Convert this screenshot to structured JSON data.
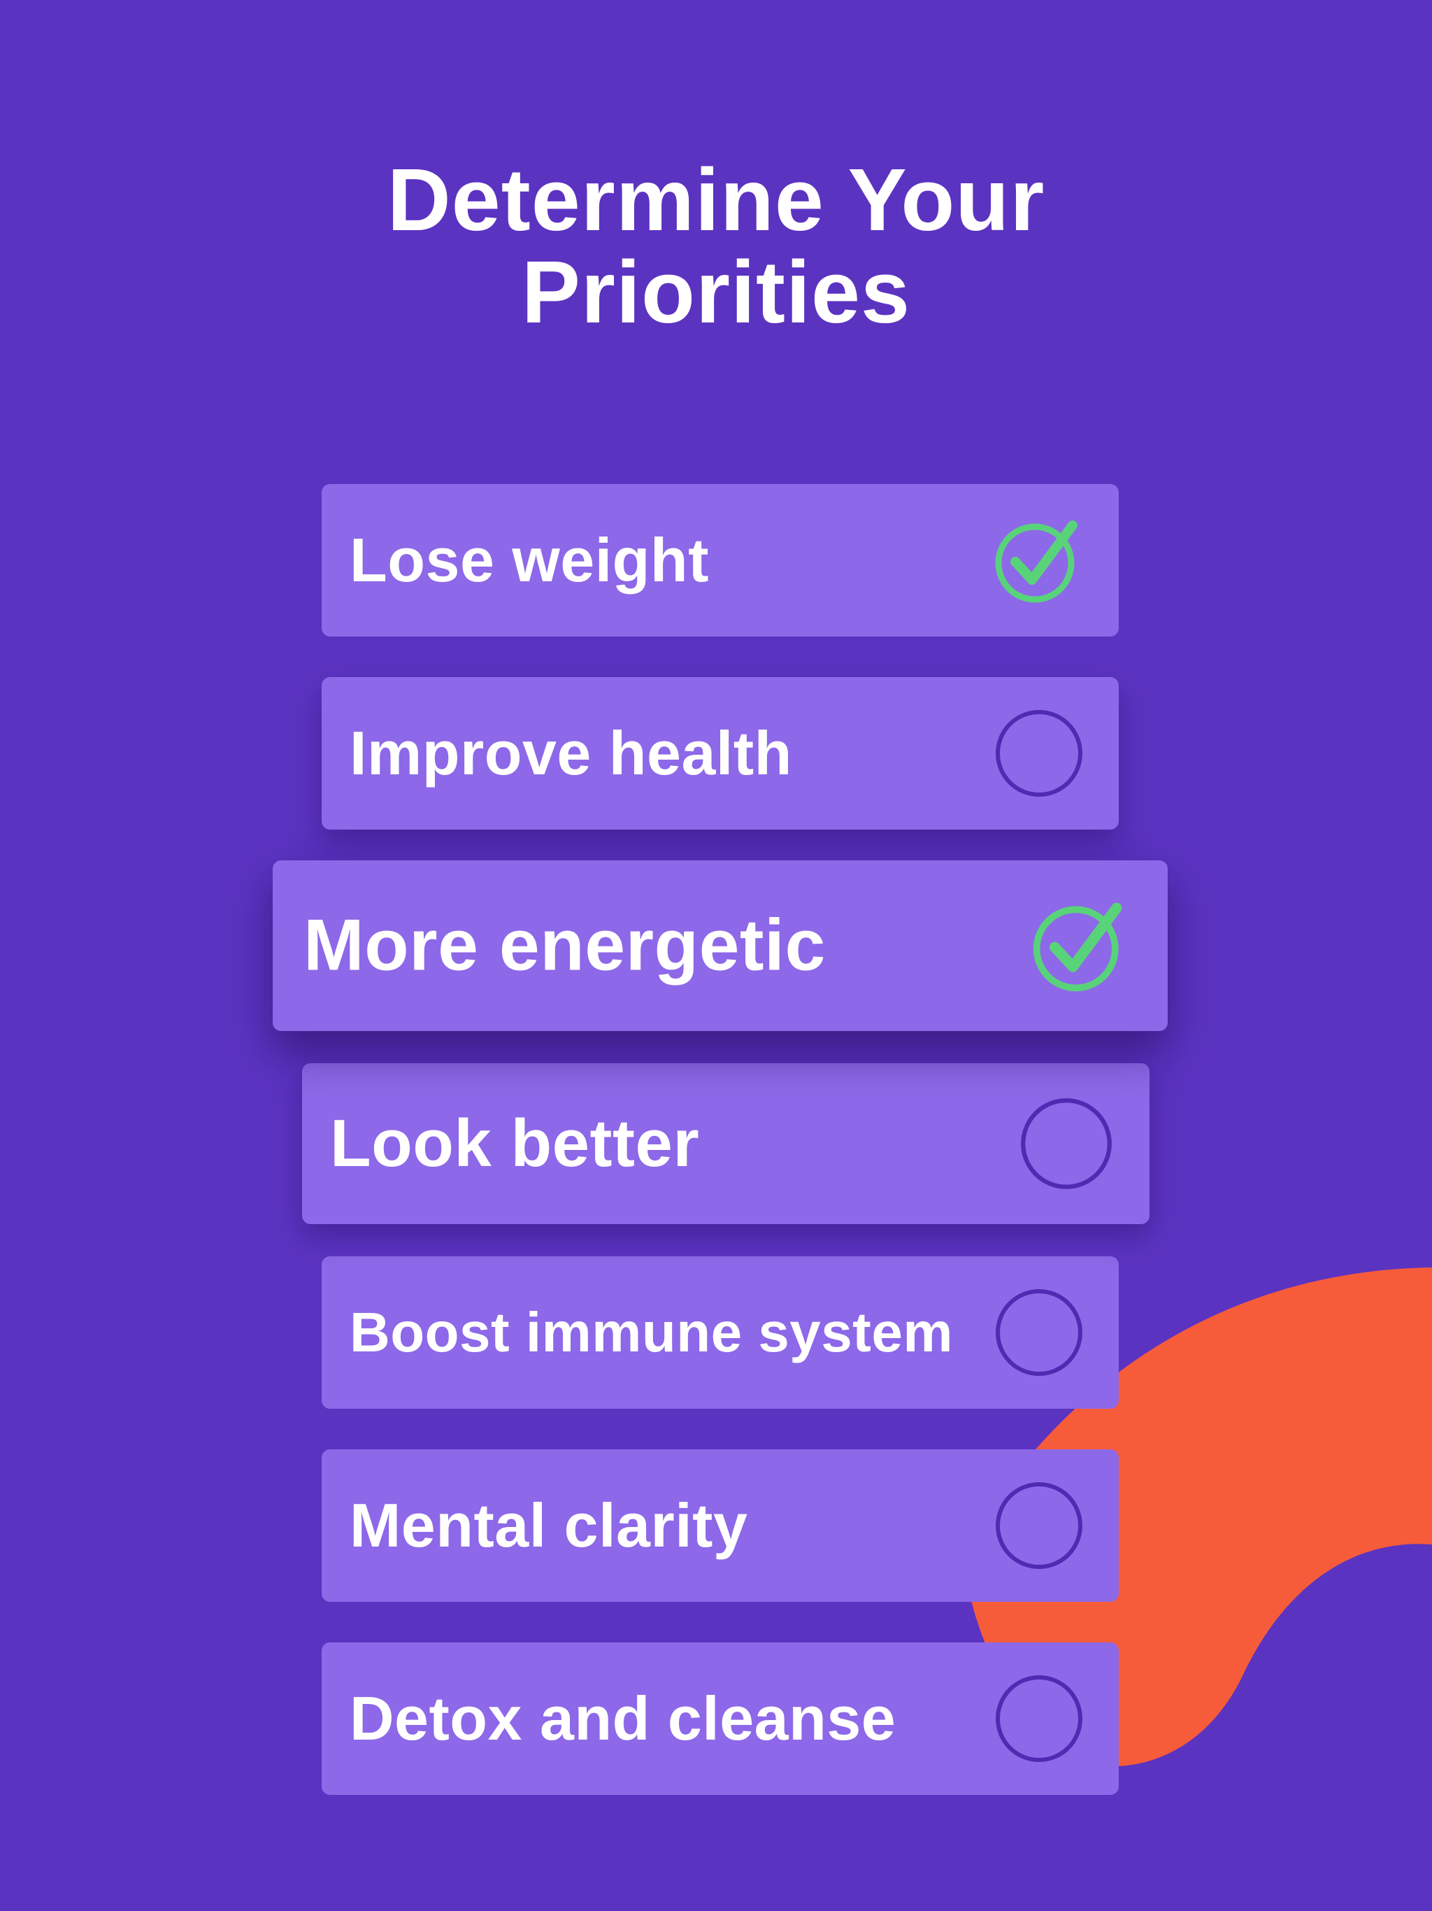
{
  "page": {
    "title_line1": "Determine Your",
    "title_line2": "Priorities",
    "background_color": "#5B33C1",
    "accent_color": "#F75C3A",
    "card_color": "#8D68E8",
    "check_color": "#59D37A",
    "unchecked_ring_color": "#4F2BB3"
  },
  "options": [
    {
      "label": "Lose weight",
      "checked": true,
      "icon": "checkmark-circle-icon"
    },
    {
      "label": "Improve health",
      "checked": false,
      "icon": "empty-circle-icon"
    },
    {
      "label": "More energetic",
      "checked": true,
      "icon": "checkmark-circle-icon"
    },
    {
      "label": "Look better",
      "checked": false,
      "icon": "empty-circle-icon"
    },
    {
      "label": "Boost immune system",
      "checked": false,
      "icon": "empty-circle-icon"
    },
    {
      "label": "Mental clarity",
      "checked": false,
      "icon": "empty-circle-icon"
    },
    {
      "label": "Detox and cleanse",
      "checked": false,
      "icon": "empty-circle-icon"
    }
  ]
}
